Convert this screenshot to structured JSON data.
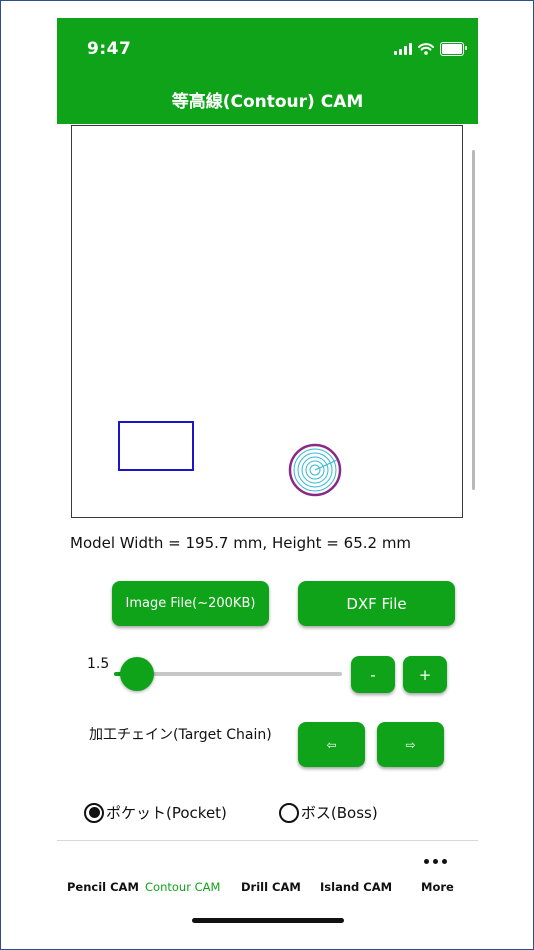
{
  "status_bar": {
    "time": "9:47",
    "signal_icon": "signal-icon",
    "wifi_icon": "wifi-icon",
    "battery_icon": "battery-icon"
  },
  "header": {
    "title": "等高線(Contour) CAM",
    "background": "#0fa31a"
  },
  "canvas": {
    "shapes": [
      {
        "type": "rectangle",
        "color": "#1c14c8"
      },
      {
        "type": "circle-pocket",
        "outline": "#8a2a86",
        "fill_lines": "#32b9d3"
      }
    ]
  },
  "model_info": {
    "text": "Model Width = 195.7 mm, Height = 65.2 mm"
  },
  "file_buttons": {
    "image_label": "Image File(~200KB)",
    "dxf_label": "DXF File"
  },
  "zoom": {
    "value_label": "1.5",
    "level_fraction": 0.1,
    "minus_label": "-",
    "plus_label": "+"
  },
  "chain": {
    "label": "加工チェイン(Target Chain)",
    "prev_label": "⇦",
    "next_label": "⇨"
  },
  "mode": {
    "options": [
      {
        "label": "ポケット(Pocket)",
        "selected": true
      },
      {
        "label": "ボス(Boss)",
        "selected": false
      }
    ]
  },
  "tabs": [
    {
      "label": "Pencil CAM",
      "active": false
    },
    {
      "label": "Contour CAM",
      "active": true
    },
    {
      "label": "Drill CAM",
      "active": false
    },
    {
      "label": "Island CAM",
      "active": false
    },
    {
      "label": "More",
      "active": false,
      "icon": "more-dots-icon"
    }
  ],
  "colors": {
    "accent": "#0fa31a",
    "text": "#111111"
  }
}
